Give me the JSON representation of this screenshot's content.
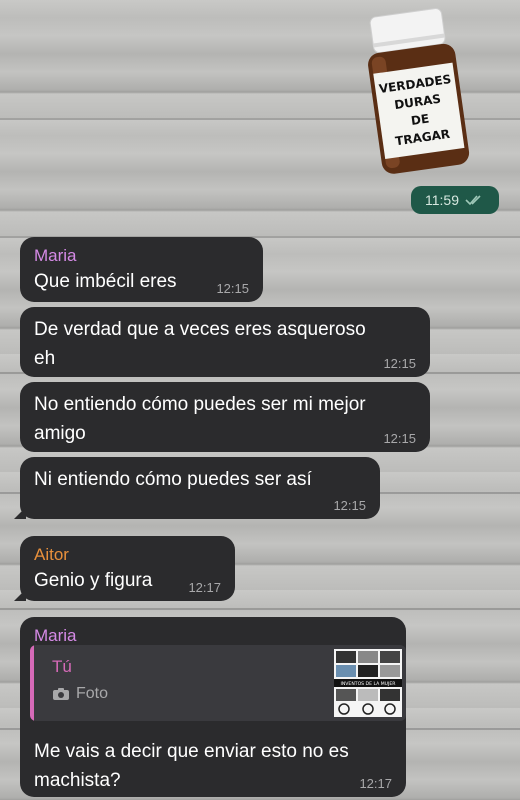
{
  "sticker": {
    "label_lines": [
      "VERDADES",
      "DURAS",
      "DE",
      "TRAGAR"
    ]
  },
  "outgoing": {
    "time": "11:59",
    "status_icon": "double-check-icon"
  },
  "messages": [
    {
      "sender": "Maria",
      "text": "Que imbécil eres",
      "time": "12:15"
    },
    {
      "text_line1": "De verdad que a veces eres asqueroso",
      "text_line2": "eh",
      "time": "12:15"
    },
    {
      "text_line1": "No entiendo cómo puedes ser mi mejor",
      "text_line2": "amigo",
      "time": "12:15"
    },
    {
      "text": "Ni entiendo cómo puedes ser así",
      "time": "12:15"
    },
    {
      "sender": "Aitor",
      "text": "Genio y figura",
      "time": "12:17"
    },
    {
      "sender": "Maria",
      "reply": {
        "name": "Tú",
        "type": "Foto",
        "thumb_caption": "INVENTOS DE LA MUJER"
      },
      "text_line1": "Me vais a decir que enviar esto no es",
      "text_line2": "machista?",
      "time": "12:17"
    }
  ],
  "colors": {
    "bubble": "#2b2b2d",
    "maria": "#d58ae6",
    "aitor": "#e8903c",
    "reply_accent": "#d66ab8",
    "outgoing": "#1f5848"
  }
}
